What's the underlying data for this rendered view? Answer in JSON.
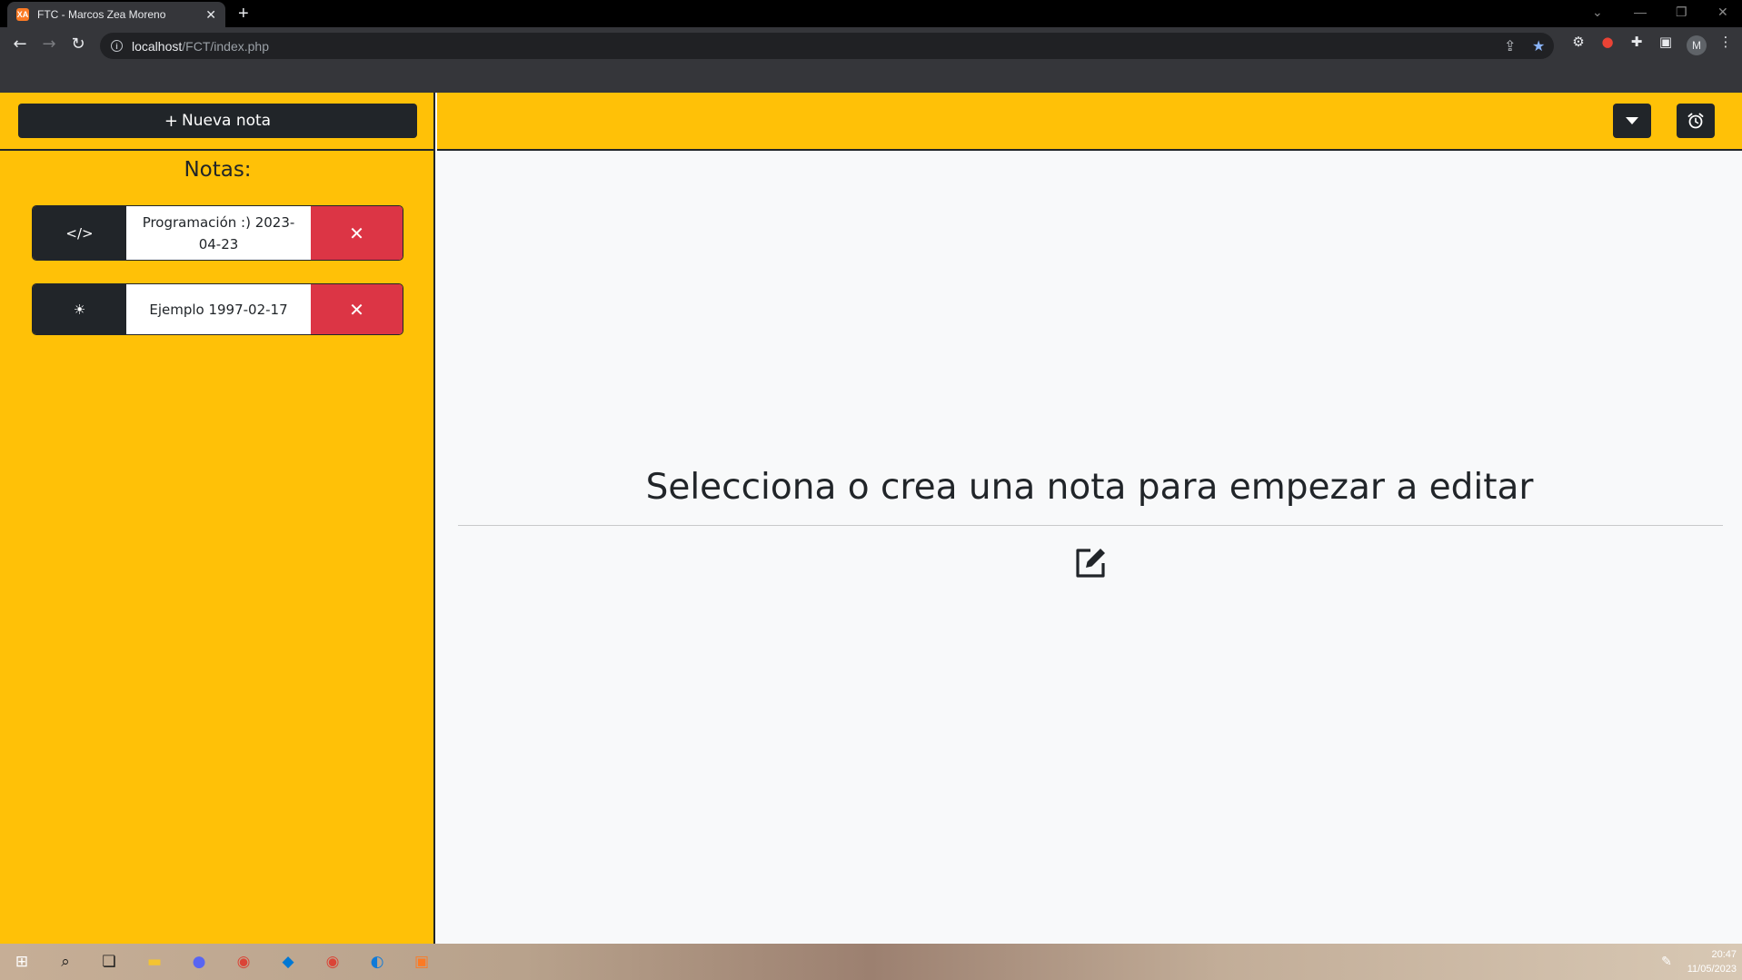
{
  "browser": {
    "tab_title": "FTC - Marcos Zea Moreno",
    "favicon_text": "XA",
    "tab_close": "✕",
    "new_tab": "+",
    "url_host": "localhost",
    "url_path": "/FCT/index.php",
    "avatar_initial": "M"
  },
  "sidebar": {
    "new_note_label": "Nueva nota",
    "notes_heading": "Notas:",
    "notes": [
      {
        "icon": "</>",
        "icon_name": "code-icon",
        "label": "Programación :) 2023-04-23"
      },
      {
        "icon": "☀",
        "icon_name": "sun-icon",
        "label": "Ejemplo 1997-02-17"
      }
    ],
    "delete_symbol": "✕"
  },
  "main": {
    "empty_message": "Selecciona o crea una nota para empezar a editar"
  },
  "taskbar": {
    "time": "20:47",
    "date": "11/05/2023"
  },
  "colors": {
    "accent": "#ffc107",
    "dark": "#212529",
    "danger": "#dc3545",
    "main_bg": "#f8f9fa"
  }
}
